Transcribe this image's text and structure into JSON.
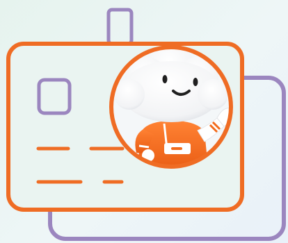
{
  "illustration": {
    "colors": {
      "background": "#eaf4f2",
      "card_outline": "#ef6c24",
      "back_card_outline": "#9b86bf",
      "mascot_body": "#ffffff",
      "mascot_shirt": "#f26a1b",
      "mascot_face": "#1f1f1f"
    },
    "icons": [
      "id-card-icon",
      "photo-placeholder-icon",
      "lanyard-clip-icon",
      "cloud-mascot-icon"
    ]
  }
}
